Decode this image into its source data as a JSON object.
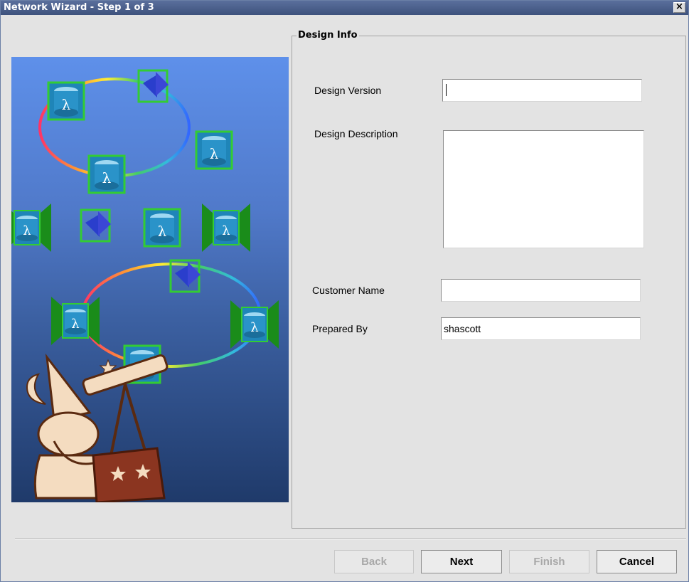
{
  "window": {
    "title": "Network Wizard - Step 1 of 3",
    "close_glyph": "×"
  },
  "panel": {
    "legend": "Design Info"
  },
  "form": {
    "design_version": {
      "label": "Design Version",
      "value": ""
    },
    "design_description": {
      "label": "Design Description",
      "value": ""
    },
    "customer_name": {
      "label": "Customer Name",
      "value": ""
    },
    "prepared_by": {
      "label": "Prepared By",
      "value": "shascott"
    }
  },
  "buttons": {
    "back": {
      "label": "Back",
      "enabled": false
    },
    "next": {
      "label": "Next",
      "enabled": true
    },
    "finish": {
      "label": "Finish",
      "enabled": false
    },
    "cancel": {
      "label": "Cancel",
      "enabled": true
    }
  },
  "illustration": {
    "node_glyph": "λ"
  },
  "colors": {
    "titlebar": "#4a5f8c",
    "node_border": "#33cc33",
    "device_body": "#1f85b8",
    "amplifier": "#1a8c1a",
    "wizard_robe": "#f4dcc0",
    "wizard_table": "#8b3520"
  }
}
